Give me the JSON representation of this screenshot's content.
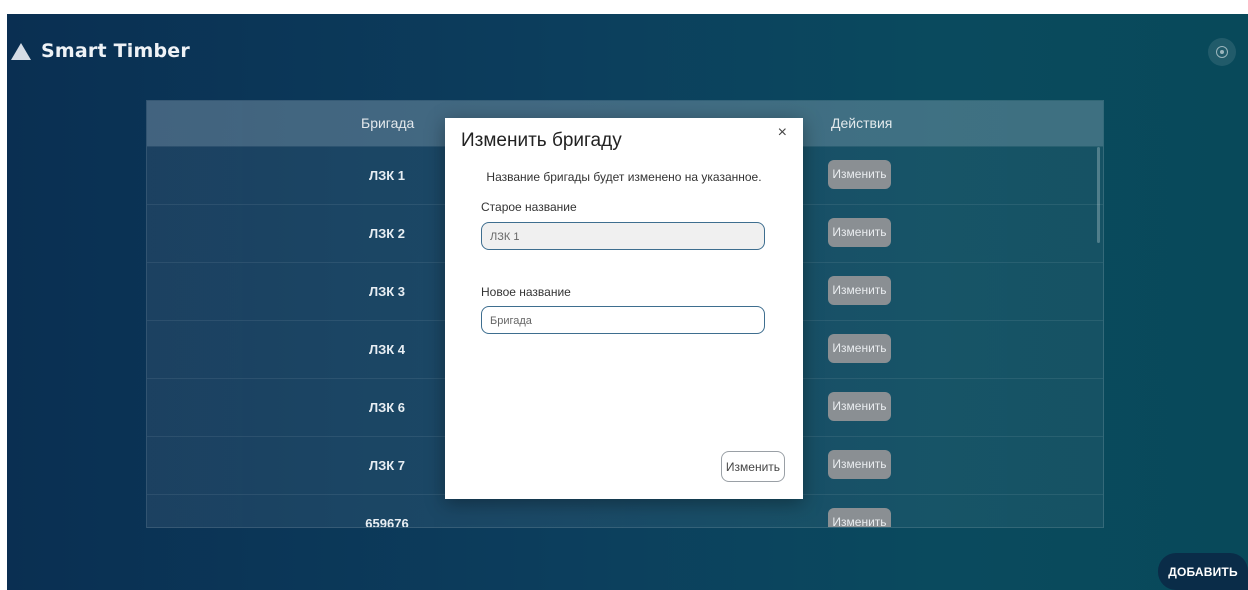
{
  "app": {
    "title": "Smart Timber",
    "add_label": "ДОБАВИТЬ"
  },
  "table": {
    "headers": {
      "name": "Бригада",
      "actions": "Действия"
    },
    "edit_label": "Изменить",
    "rows": [
      {
        "name": "ЛЗК 1"
      },
      {
        "name": "ЛЗК 2"
      },
      {
        "name": "ЛЗК 3"
      },
      {
        "name": "ЛЗК 4"
      },
      {
        "name": "ЛЗК 6"
      },
      {
        "name": "ЛЗК 7"
      },
      {
        "name": "659676"
      }
    ]
  },
  "modal": {
    "title": "Изменить бригаду",
    "close": "×",
    "description": "Название бригады будет изменено на указанное.",
    "old_label": "Старое название",
    "old_value": "ЛЗК 1",
    "new_label": "Новое название",
    "new_placeholder": "Бригада",
    "submit_label": "Изменить"
  },
  "icons": {
    "logo": "triangle-logo-icon",
    "settings": "settings-icon"
  },
  "colors": {
    "background_left": "#0a2f52",
    "background_right": "#08495a",
    "edit_button": "#8a8f93",
    "add_button": "#0a2c48",
    "input_border": "#3e6e8f"
  }
}
